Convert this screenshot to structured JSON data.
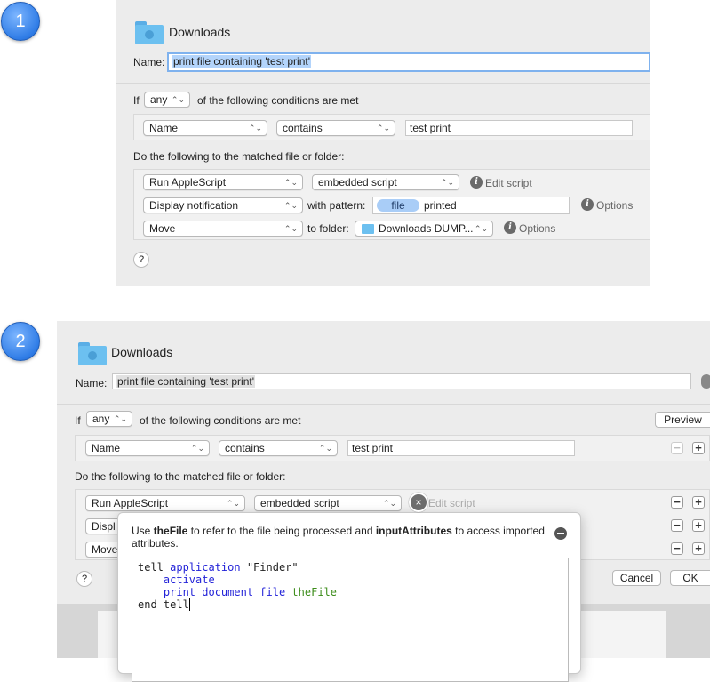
{
  "steps": [
    "1",
    "2"
  ],
  "panel1": {
    "folder_name": "Downloads",
    "name_label": "Name:",
    "name_value": "print file containing 'test print'",
    "if_label": "If",
    "match_mode": "any",
    "conditions_suffix": "of the following conditions are met",
    "condition": {
      "attribute": "Name",
      "operator": "contains",
      "value": "test print"
    },
    "actions_heading": "Do the following to the matched file or folder:",
    "actions": [
      {
        "action": "Run AppleScript",
        "option": "embedded script",
        "info": "Edit script"
      },
      {
        "action": "Display notification",
        "with": "with pattern:",
        "token": "file",
        "pattern_text": "printed",
        "info": "Options"
      },
      {
        "action": "Move",
        "with": "to folder:",
        "folder": "Downloads DUMP...",
        "info": "Options"
      }
    ],
    "help": "?"
  },
  "panel2": {
    "folder_name": "Downloads",
    "name_label": "Name:",
    "name_value": "print file containing 'test print'",
    "if_label": "If",
    "match_mode": "any",
    "conditions_suffix": "of the following conditions are met",
    "preview_button": "Preview",
    "condition": {
      "attribute": "Name",
      "operator": "contains",
      "value": "test print"
    },
    "actions_heading": "Do the following to the matched file or folder:",
    "actions": [
      {
        "action": "Run AppleScript",
        "option": "embedded script",
        "info": "Edit script"
      },
      {
        "action": "Displ"
      },
      {
        "action": "Move"
      }
    ],
    "help": "?",
    "cancel_button": "Cancel",
    "ok_button": "OK",
    "remove_symbol": "−",
    "add_symbol": "+"
  },
  "popover": {
    "help_prefix": "Use ",
    "help_var1": "theFile",
    "help_middle": " to refer to the file being processed and ",
    "help_var2": "inputAttributes",
    "help_suffix": " to access imported attributes.",
    "code_line1_a": "tell ",
    "code_line1_b": "application",
    "code_line1_c": " \"Finder\"",
    "code_line2": "activate",
    "code_line3_a": "print document file",
    "code_line3_b": "theFile",
    "code_line4": "end tell",
    "close_symbol": "×"
  },
  "colors": {
    "accent": "#2f7ce6",
    "token": "#a9cdf7",
    "panel": "#ececec"
  }
}
